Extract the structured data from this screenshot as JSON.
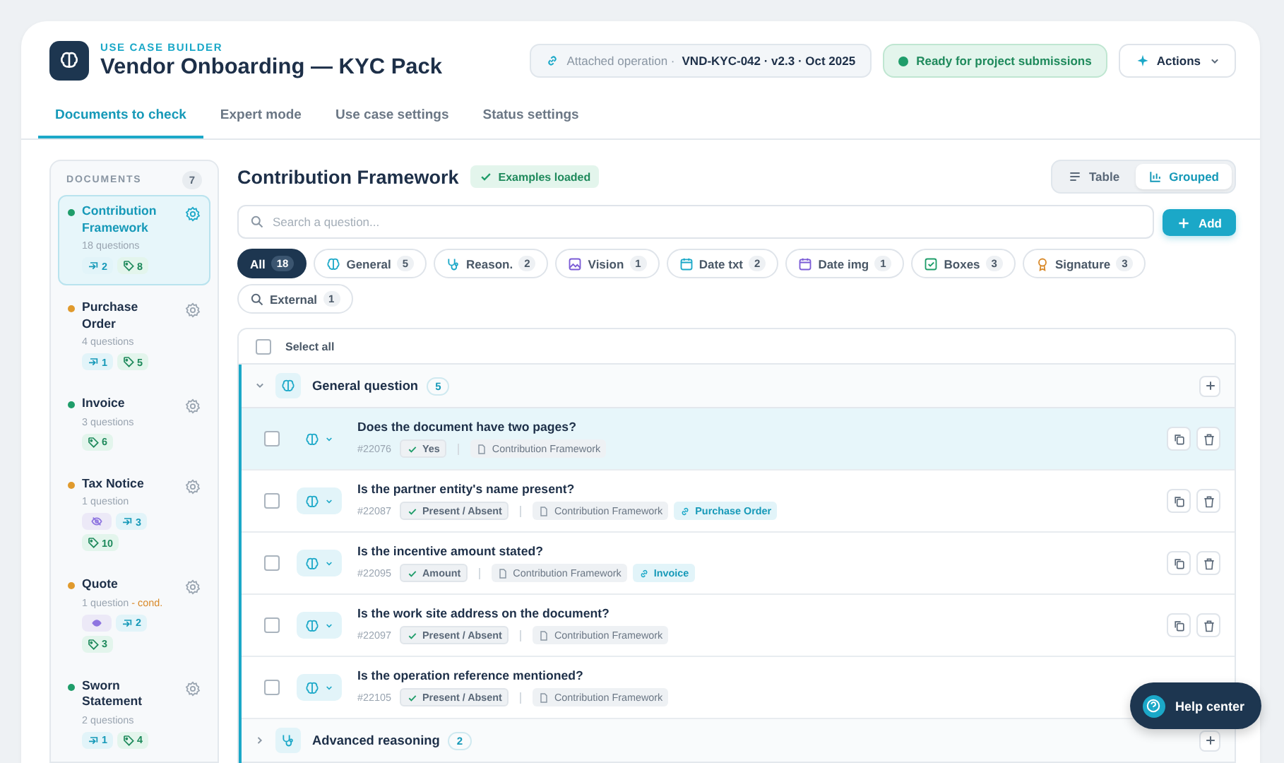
{
  "header": {
    "eyebrow": "USE CASE BUILDER",
    "title": "Vendor Onboarding — KYC Pack",
    "attached_label": "Attached operation ·",
    "attached_value": "VND-KYC-042 · v2.3 · Oct 2025",
    "status": "Ready for project submissions",
    "actions": "Actions"
  },
  "tabs": [
    {
      "label": "Documents to check",
      "selected": true
    },
    {
      "label": "Expert mode",
      "selected": false
    },
    {
      "label": "Use case settings",
      "selected": false
    },
    {
      "label": "Status settings",
      "selected": false
    }
  ],
  "sidebar": {
    "title": "DOCUMENTS",
    "count": "7",
    "items": [
      {
        "name": "Contribution Framework",
        "color": "#1f9d6a",
        "questions": "18 questions",
        "selected": true,
        "chips": [
          {
            "kind": "link",
            "count": "2"
          },
          {
            "kind": "tag",
            "count": "8"
          }
        ]
      },
      {
        "name": "Purchase Order",
        "color": "#e09a2d",
        "questions": "4 questions",
        "selected": false,
        "chips": [
          {
            "kind": "link",
            "count": "1"
          },
          {
            "kind": "tag",
            "count": "5"
          }
        ]
      },
      {
        "name": "Invoice",
        "color": "#1f9d6a",
        "questions": "3 questions",
        "selected": false,
        "chips": [
          {
            "kind": "tag",
            "count": "6"
          }
        ]
      },
      {
        "name": "Tax Notice",
        "color": "#e09a2d",
        "questions": "1 question",
        "selected": false,
        "chips": [
          {
            "kind": "hidden"
          },
          {
            "kind": "link",
            "count": "3"
          },
          {
            "kind": "tag",
            "count": "10"
          }
        ]
      },
      {
        "name": "Quote",
        "color": "#e09a2d",
        "questions": "1 question",
        "condition": "- cond.",
        "selected": false,
        "chips": [
          {
            "kind": "vision"
          },
          {
            "kind": "link",
            "count": "2"
          },
          {
            "kind": "tag",
            "count": "3"
          }
        ]
      },
      {
        "name": "Sworn Statement",
        "color": "#1f9d6a",
        "questions": "2 questions",
        "selected": false,
        "chips": [
          {
            "kind": "link",
            "count": "1"
          },
          {
            "kind": "tag",
            "count": "4"
          }
        ]
      }
    ]
  },
  "main": {
    "title": "Contribution Framework",
    "badge": "Examples loaded",
    "views": [
      {
        "label": "Table",
        "kind": "table",
        "selected": false
      },
      {
        "label": "Grouped",
        "kind": "grouped",
        "selected": true
      }
    ],
    "search": {
      "placeholder": "Search a question..."
    },
    "add": "Add",
    "filters": [
      {
        "label": "All",
        "count": "18",
        "kind": "all",
        "selected": true
      },
      {
        "label": "General",
        "count": "5",
        "kind": "general",
        "selected": false
      },
      {
        "label": "Reason.",
        "count": "2",
        "kind": "reasoning",
        "selected": false
      },
      {
        "label": "Vision",
        "count": "1",
        "kind": "vision",
        "selected": false
      },
      {
        "label": "Date txt",
        "count": "2",
        "kind": "date_txt",
        "selected": false
      },
      {
        "label": "Date img",
        "count": "1",
        "kind": "date_img",
        "selected": false
      },
      {
        "label": "Boxes",
        "count": "3",
        "kind": "boxes",
        "selected": false
      },
      {
        "label": "Signature",
        "count": "3",
        "kind": "signature",
        "selected": false
      },
      {
        "label": "External",
        "count": "1",
        "kind": "external",
        "selected": false
      }
    ],
    "select_all": {
      "label": "Select all",
      "checked": false
    },
    "groups": [
      {
        "name": "General question",
        "count": "5",
        "kind": "general",
        "expanded": true,
        "questions": [
          {
            "text": "Does the document have two pages?",
            "id": "#22076",
            "answer": "Yes",
            "source": "Contribution Framework",
            "selected": true,
            "checked": false,
            "actions_shown": true
          },
          {
            "text": "Is the partner entity's name present?",
            "id": "#22087",
            "answer": "Present / Absent",
            "source": "Contribution Framework",
            "link": "Purchase Order",
            "selected": false,
            "checked": false,
            "actions_shown": true
          },
          {
            "text": "Is the incentive amount stated?",
            "id": "#22095",
            "answer": "Amount",
            "source": "Contribution Framework",
            "link": "Invoice",
            "selected": false,
            "checked": false,
            "actions_shown": true
          },
          {
            "text": "Is the work site address on the document?",
            "id": "#22097",
            "answer": "Present / Absent",
            "source": "Contribution Framework",
            "selected": false,
            "checked": false,
            "actions_shown": true
          },
          {
            "text": "Is the operation reference mentioned?",
            "id": "#22105",
            "answer": "Present / Absent",
            "source": "Contribution Framework",
            "selected": false,
            "checked": false,
            "actions_shown": false
          }
        ]
      },
      {
        "name": "Advanced reasoning",
        "count": "2",
        "kind": "reasoning",
        "expanded": false
      }
    ]
  },
  "help": "Help center"
}
